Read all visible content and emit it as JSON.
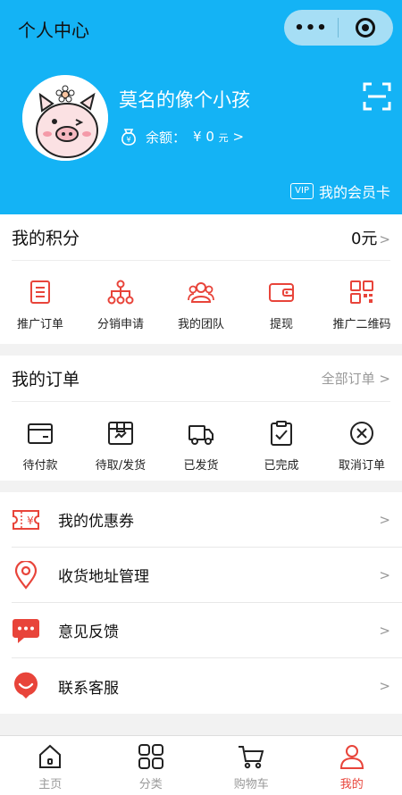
{
  "nav": {
    "title": "个人中心",
    "menu_icon": "more-dots-icon",
    "close_icon": "target-icon"
  },
  "profile": {
    "name": "莫名的像个小孩",
    "balance_label": "余额：",
    "balance_currency": "¥",
    "balance_value": "0",
    "balance_unit": "元",
    "balance_arrow": ">",
    "vip_badge": "VIP",
    "vip_label": "我的会员卡"
  },
  "points": {
    "title": "我的积分",
    "value": "0元",
    "arrow": ">",
    "items": [
      {
        "label": "推广订单",
        "icon": "document-icon"
      },
      {
        "label": "分销申请",
        "icon": "hierarchy-icon"
      },
      {
        "label": "我的团队",
        "icon": "team-icon"
      },
      {
        "label": "提现",
        "icon": "wallet-icon"
      },
      {
        "label": "推广二维码",
        "icon": "qrcode-icon"
      }
    ]
  },
  "orders": {
    "title": "我的订单",
    "all_label": "全部订单",
    "arrow": ">",
    "items": [
      {
        "label": "待付款",
        "icon": "card-icon"
      },
      {
        "label": "待取/发货",
        "icon": "box-icon"
      },
      {
        "label": "已发货",
        "icon": "truck-icon"
      },
      {
        "label": "已完成",
        "icon": "clipboard-check-icon"
      },
      {
        "label": "取消订单",
        "icon": "cancel-circle-icon"
      }
    ]
  },
  "menu": {
    "arrow": ">",
    "items": [
      {
        "label": "我的优惠券",
        "icon": "coupon-icon"
      },
      {
        "label": "收货地址管理",
        "icon": "location-icon"
      },
      {
        "label": "意见反馈",
        "icon": "chat-icon"
      },
      {
        "label": "联系客服",
        "icon": "smile-icon"
      }
    ]
  },
  "tabbar": {
    "active": "我的",
    "items": [
      {
        "label": "主页",
        "icon": "home-icon"
      },
      {
        "label": "分类",
        "icon": "grid-icon"
      },
      {
        "label": "购物车",
        "icon": "cart-icon"
      },
      {
        "label": "我的",
        "icon": "user-icon"
      }
    ]
  },
  "colors": {
    "brand": "#14b3f5",
    "accent": "#e8443a",
    "text_gray": "#999999"
  }
}
